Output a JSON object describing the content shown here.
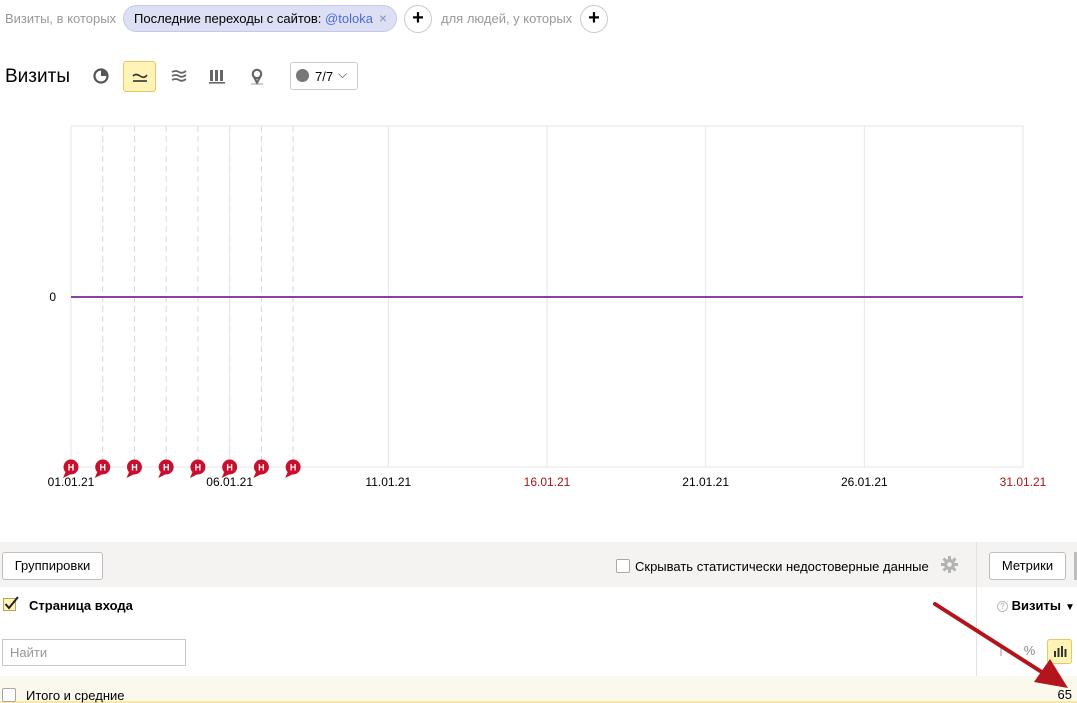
{
  "segment": {
    "prefix": "Визиты, в которых",
    "chip_label": "Последние переходы с сайтов: ",
    "chip_value": "@toloka",
    "chip_remove": "×",
    "add": "+",
    "people_label": "для людей, у которых"
  },
  "chart_toolbar": {
    "title": "Визиты",
    "views": [
      "pie-chart-icon",
      "line-chart-icon",
      "area-chart-icon",
      "bar-chart-icon",
      "map-icon"
    ],
    "active_view": "line-chart-icon",
    "annotations_dropdown": {
      "icon": "comment-bubble-icon",
      "value": "7/7",
      "chevron": "⌵"
    }
  },
  "chart_data": {
    "type": "line",
    "ylabel_ticks": [
      "0"
    ],
    "x_tick_labels": [
      "01.01.21",
      "06.01.21",
      "11.01.21",
      "16.01.21",
      "21.01.21",
      "26.01.21",
      "31.01.21"
    ],
    "holiday_ticks": [
      "16.01.21",
      "31.01.21"
    ],
    "x_range": [
      "01.01.21",
      "31.01.21"
    ],
    "series": [
      {
        "color": "#8e3fa5",
        "x": [
          "01.01.21",
          "31.01.21"
        ],
        "y": [
          0,
          0
        ]
      }
    ],
    "holiday_markers": {
      "label": "Н",
      "color": "#c8102e",
      "dates": [
        "01.01.21",
        "02.01.21",
        "03.01.21",
        "04.01.21",
        "05.01.21",
        "06.01.21",
        "07.01.21",
        "08.01.21"
      ]
    },
    "grid": true
  },
  "report": {
    "grouping_button": "Группировки",
    "hide_unreliable_label": "Скрывать статистически недостоверные данные",
    "metrics_button": "Метрики",
    "dimension_title": "Страница входа",
    "metric_column": "Визиты",
    "help_mark": "?",
    "sort_arrow": "▼",
    "search_placeholder": "Найти",
    "view_buttons": [
      "list-view-icon",
      "percent-view-icon",
      "bar-view-icon"
    ],
    "percent_symbol": "%",
    "totals_label": "Итого и средние",
    "totals_value": "65"
  },
  "colors": {
    "accent_yellow": "#fff3b6",
    "chip_bg": "#dde0f5",
    "series": "#8e3fa5",
    "holiday": "#c8102e",
    "annotation_arrow": "#b4141c"
  }
}
